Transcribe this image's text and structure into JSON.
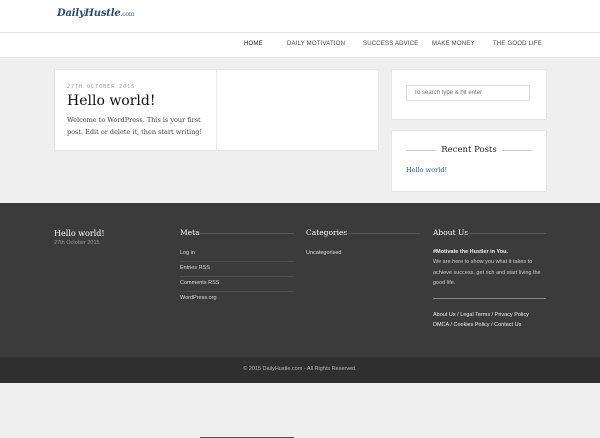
{
  "brand": {
    "logo_main": "DailyHustle",
    "logo_domain": ".com"
  },
  "nav": {
    "items": [
      {
        "label": "HOME"
      },
      {
        "label": "DAILY MOTIVATION"
      },
      {
        "label": "SUCCESS ADVICE"
      },
      {
        "label": "MAKE MONEY"
      },
      {
        "label": "THE GOOD LIFE"
      }
    ]
  },
  "post": {
    "date": "27th October 2015",
    "title": "Hello world!",
    "excerpt": "Welcome to WordPress. This is your first post. Edit or delete it, then start writing!"
  },
  "sidebar": {
    "search_placeholder": "To search type & hit enter",
    "recent_title": "Recent Posts",
    "recent_items": [
      "Hello world!"
    ]
  },
  "footer": {
    "latest_post_title": "Hello world!",
    "latest_post_date": "27th October 2015",
    "meta": {
      "heading": "Meta",
      "links": [
        "Log in",
        "Entries RSS",
        "Comments RSS",
        "WordPress.org"
      ]
    },
    "categories": {
      "heading": "Categories",
      "links": [
        "Uncategorised"
      ]
    },
    "about": {
      "heading": "About Us",
      "tagline": "#Motivate the Hustler in You.",
      "text": "We are here to show you what it takes to achieve success, get rich and start living the good life.",
      "links_line1": "About Us / Legal Terms / Privacy Policy",
      "links_line2": "DMCA / Cookies Policy / Contact Us"
    }
  },
  "copyright": "© 2015 DailyHustle.com - All Rights Reserved.",
  "colors": {
    "accent": "#2a5b8f",
    "footer_bg": "#3b3b3b",
    "bottom_bg": "#2f2f2f"
  }
}
